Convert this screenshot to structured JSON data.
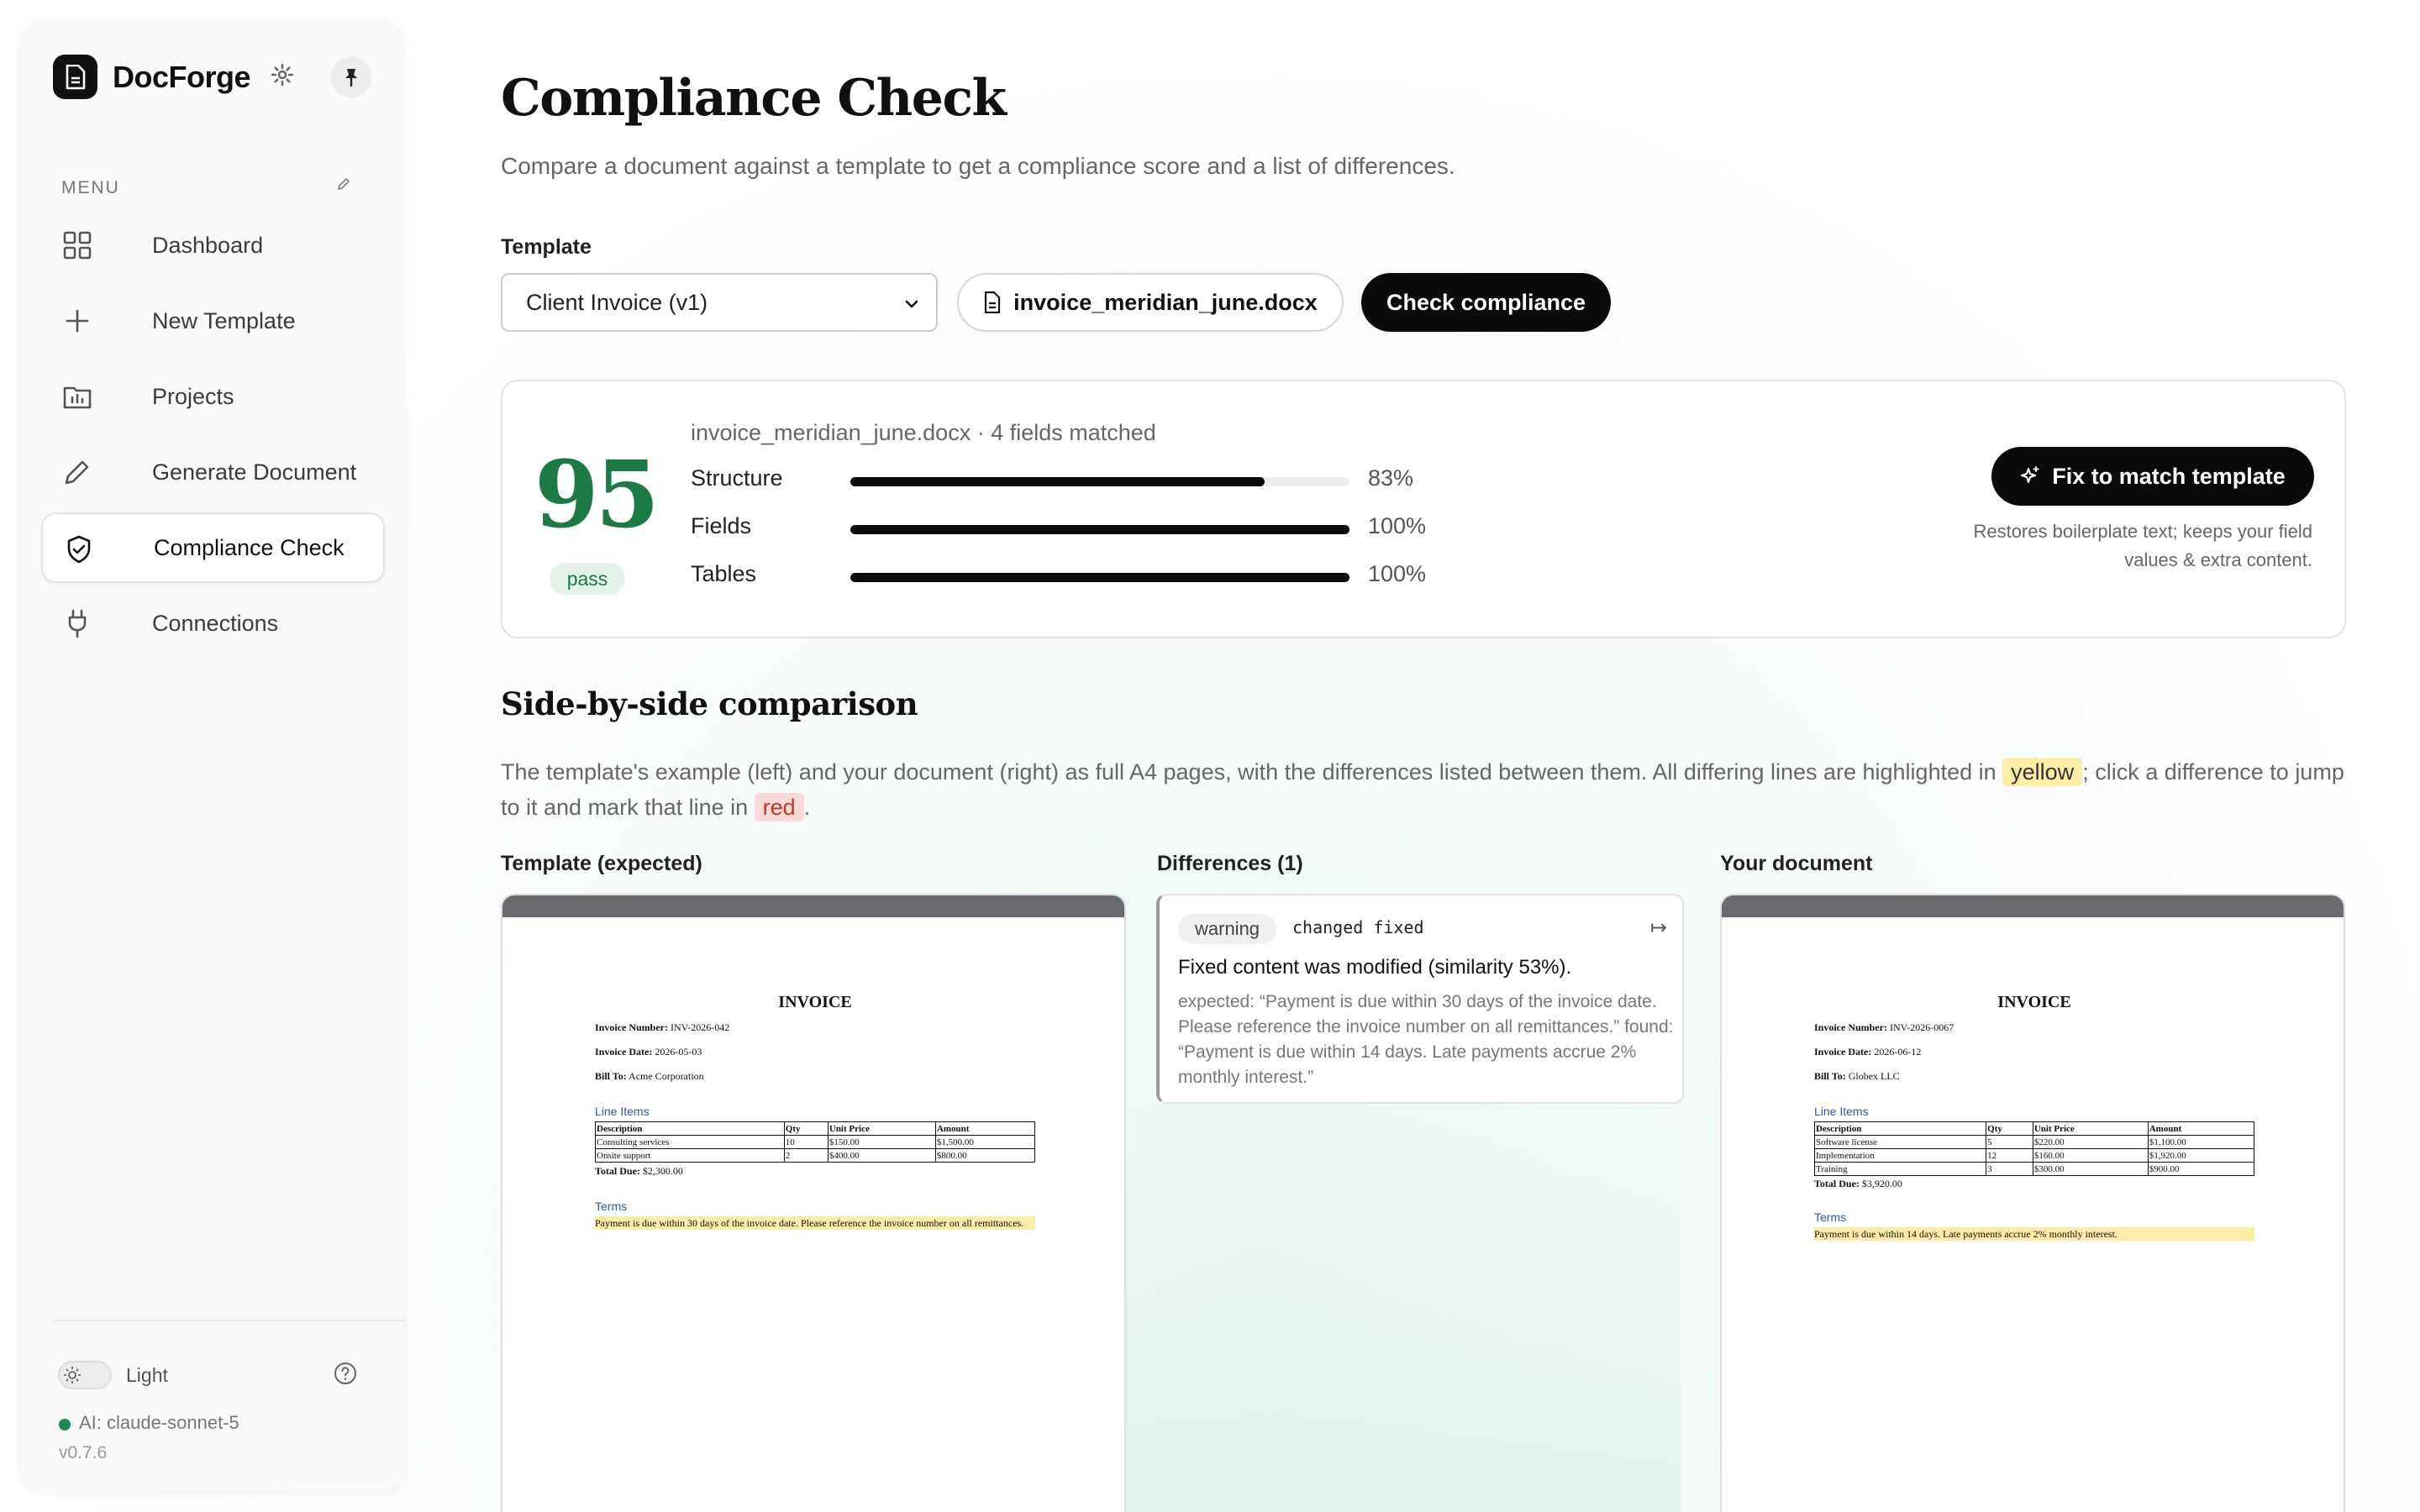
{
  "sidebar": {
    "brand": "DocForge",
    "menu_label": "MENU",
    "items": [
      {
        "label": "Dashboard"
      },
      {
        "label": "New Template"
      },
      {
        "label": "Projects"
      },
      {
        "label": "Generate Document"
      },
      {
        "label": "Compliance Check"
      },
      {
        "label": "Connections"
      }
    ],
    "theme_label": "Light",
    "ai_label": "AI: claude-sonnet-5",
    "version": "v0.7.6"
  },
  "page": {
    "title": "Compliance Check",
    "subtitle": "Compare a document against a template to get a compliance score and a list of differences."
  },
  "controls": {
    "template_label": "Template",
    "template_selected": "Client Invoice (v1)",
    "file_name": "invoice_meridian_june.docx",
    "check_label": "Check compliance"
  },
  "score": {
    "value": "95",
    "status": "pass",
    "meta": "invoice_meridian_june.docx · 4 fields matched",
    "metrics": [
      {
        "name": "Structure",
        "value": "83%",
        "fraction": 0.83
      },
      {
        "name": "Fields",
        "value": "100%",
        "fraction": 1.0
      },
      {
        "name": "Tables",
        "value": "100%",
        "fraction": 1.0
      }
    ],
    "fix_label": "Fix to match template",
    "fix_note": "Restores boilerplate text; keeps your field values & extra content."
  },
  "comparison": {
    "title": "Side-by-side comparison",
    "desc_1": "The template's example (left) and your document (right) as full A4 pages, with the differences listed between them. All differing lines are highlighted in ",
    "yellow": "yellow",
    "desc_2": "; click a difference to jump to it and mark that line in ",
    "red": "red",
    "desc_3": ".",
    "left_label": "Template (expected)",
    "middle_label": "Differences (1)",
    "right_label": "Your document"
  },
  "diff": {
    "severity": "warning",
    "kind": "changed fixed",
    "jump_icon": "↦",
    "message": "Fixed content was modified (similarity 53%).",
    "detail": "expected: “Payment is due within 30 days of the invoice date. Please reference the invoice number on all remittances.” found: “Payment is due within 14 days. Late payments accrue 2% monthly interest.”"
  },
  "template_doc": {
    "title": "INVOICE",
    "number_label": "Invoice Number:",
    "number": "INV-2026-042",
    "date_label": "Invoice Date:",
    "date": "2026-05-03",
    "bill_label": "Bill To:",
    "bill": "Acme Corporation",
    "items_heading": "Line Items",
    "headers": [
      "Description",
      "Qty",
      "Unit Price",
      "Amount"
    ],
    "rows": [
      [
        "Consulting services",
        "10",
        "$150.00",
        "$1,500.00"
      ],
      [
        "Onsite support",
        "2",
        "$400.00",
        "$800.00"
      ]
    ],
    "total_label": "Total Due:",
    "total": "$2,300.00",
    "terms_heading": "Terms",
    "terms": "Payment is due within 30 days of the invoice date. Please reference the invoice number on all remittances."
  },
  "user_doc": {
    "title": "INVOICE",
    "number_label": "Invoice Number:",
    "number": "INV-2026-0067",
    "date_label": "Invoice Date:",
    "date": "2026-06-12",
    "bill_label": "Bill To:",
    "bill": "Globex LLC",
    "items_heading": "Line Items",
    "headers": [
      "Description",
      "Qty",
      "Unit Price",
      "Amount"
    ],
    "rows": [
      [
        "Software license",
        "5",
        "$220.00",
        "$1,100.00"
      ],
      [
        "Implementation",
        "12",
        "$160.00",
        "$1,920.00"
      ],
      [
        "Training",
        "3",
        "$300.00",
        "$900.00"
      ]
    ],
    "total_label": "Total Due:",
    "total": "$3,920.00",
    "terms_heading": "Terms",
    "terms": "Payment is due within 14 days. Late payments accrue 2% monthly interest."
  }
}
